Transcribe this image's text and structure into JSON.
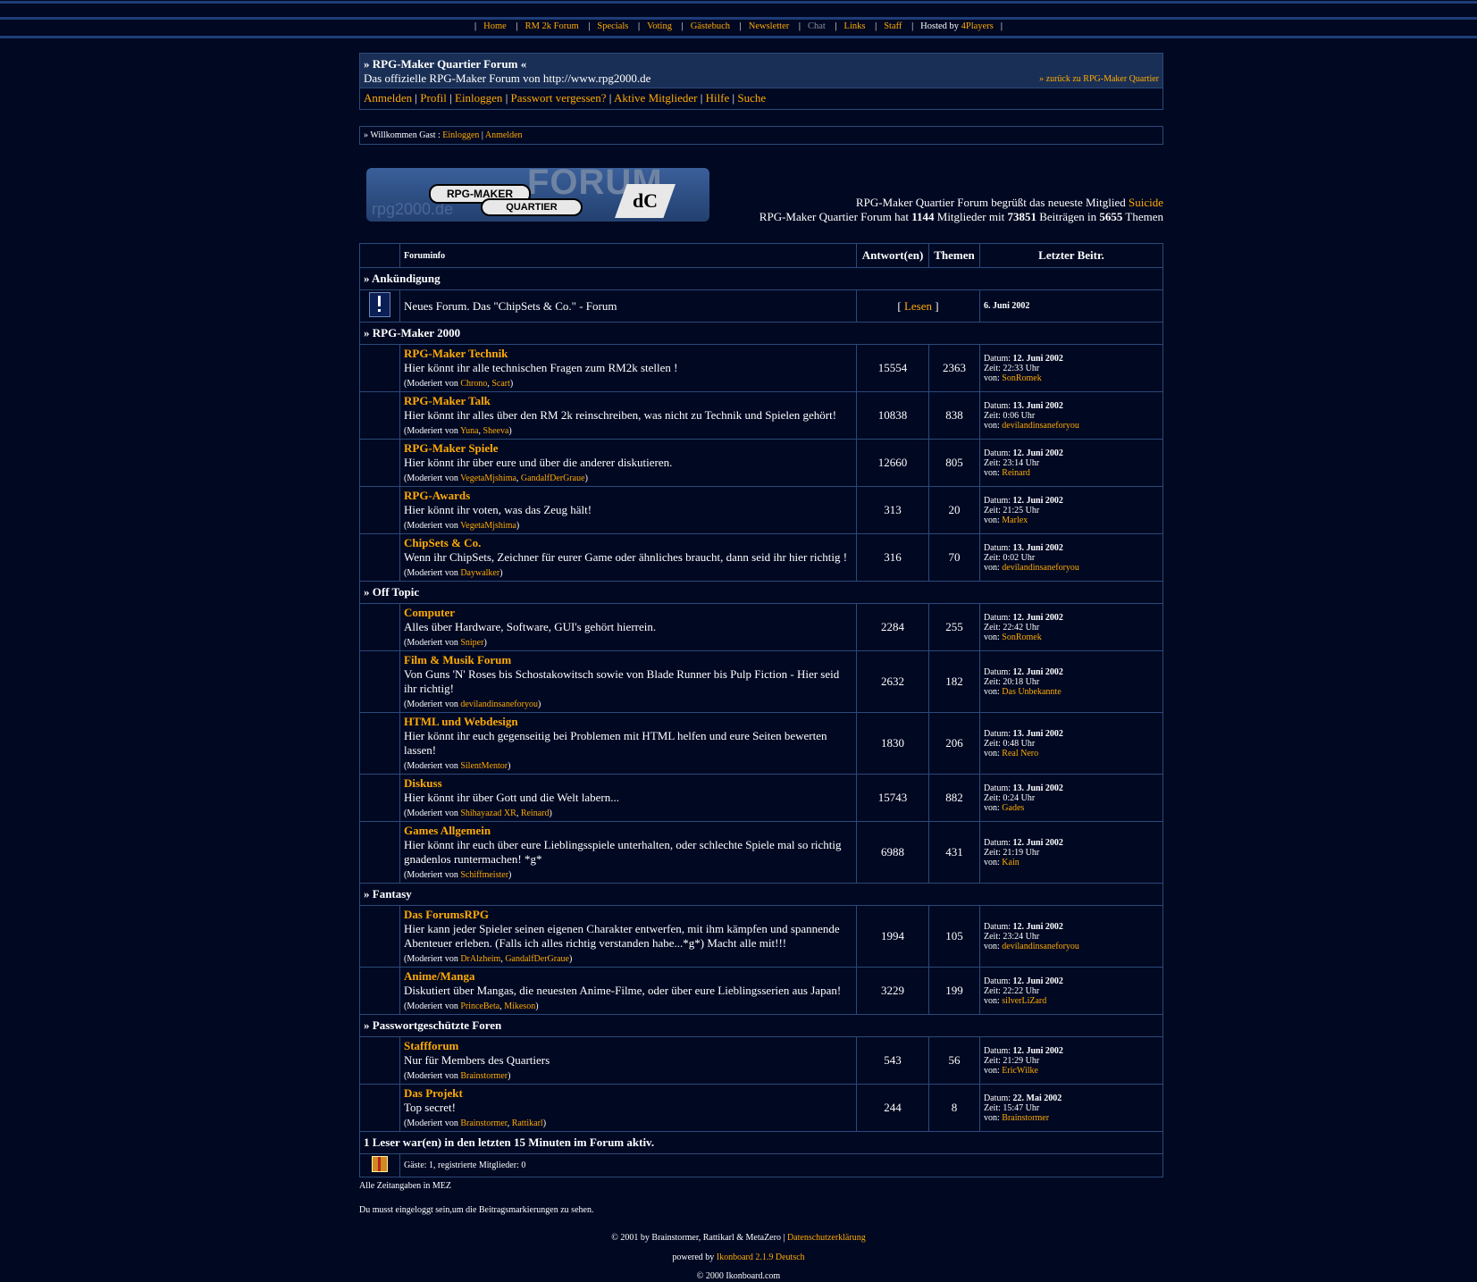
{
  "topnav": {
    "home": "Home",
    "rm2k": "RM 2k Forum",
    "specials": "Specials",
    "voting": "Voting",
    "guestbook": "Gästebuch",
    "newsletter": "Newsletter",
    "chat": "Chat",
    "links": "Links",
    "staff": "Staff",
    "hosted_prefix": "Hosted by",
    "hosted_name": "4Players"
  },
  "header": {
    "title": "» RPG-Maker Quartier Forum «",
    "subtitle": "Das offizielle RPG-Maker Forum von http://www.rpg2000.de",
    "back_link": "» zurück zu RPG-Maker Quartier"
  },
  "usernav": [
    "Anmelden",
    "Profil",
    "Einloggen",
    "Passwort vergessen?",
    "Aktive Mitglieder",
    "Hilfe",
    "Suche"
  ],
  "welcome": {
    "prefix": "» Willkommen Gast :",
    "login": "Einloggen",
    "register": "Anmelden"
  },
  "logo": {
    "line1": "RPG-MAKER",
    "line2": "QUARTIER",
    "big": "FORUM",
    "faint": "rpg2000.de",
    "badge": "dC"
  },
  "stats": {
    "line1_prefix": "RPG-Maker Quartier Forum begrüßt das neueste Mitglied",
    "newest_member": "Suicide",
    "line2_a": "RPG-Maker Quartier Forum hat",
    "members": "1144",
    "line2_b": "Mitglieder mit",
    "posts": "73851",
    "line2_c": "Beiträgen in",
    "topics": "5655",
    "line2_d": "Themen"
  },
  "columns": {
    "info": "Foruminfo",
    "replies": "Antwort(en)",
    "topics": "Themen",
    "last": "Letzter Beitr."
  },
  "announcement": {
    "category": "» Ankündigung",
    "text": "Neues Forum. Das \"ChipSets & Co.\" - Forum",
    "read": "Lesen",
    "date": "6. Juni 2002"
  },
  "labels": {
    "moderated": "(Moderiert von",
    "date": "Datum:",
    "time": "Zeit:",
    "by": "von:"
  },
  "categories": [
    {
      "name": "» RPG-Maker 2000",
      "forums": [
        {
          "name": "RPG-Maker Technik",
          "desc": "Hier könnt ihr alle technischen Fragen zum RM2k stellen !",
          "mods": [
            "Chrono",
            "Scart"
          ],
          "replies": "15554",
          "topics": "2363",
          "date": "12. Juni 2002",
          "time": "22:33 Uhr",
          "by": "SonRomek"
        },
        {
          "name": "RPG-Maker Talk",
          "desc": "Hier könnt ihr alles über den RM 2k reinschreiben, was nicht zu Technik und Spielen gehört!",
          "mods": [
            "Yuna",
            "Sheeva"
          ],
          "replies": "10838",
          "topics": "838",
          "date": "13. Juni 2002",
          "time": "0:06 Uhr",
          "by": "devilandinsaneforyou"
        },
        {
          "name": "RPG-Maker Spiele",
          "desc": "Hier könnt ihr über eure und über die anderer diskutieren.",
          "mods": [
            "VegetaMjshima",
            "GandalfDerGraue"
          ],
          "replies": "12660",
          "topics": "805",
          "date": "12. Juni 2002",
          "time": "23:14 Uhr",
          "by": "Reinard"
        },
        {
          "name": "RPG-Awards",
          "desc": "Hier könnt ihr voten, was das Zeug hält!",
          "mods": [
            "VegetaMjshima"
          ],
          "replies": "313",
          "topics": "20",
          "date": "12. Juni 2002",
          "time": "21:25 Uhr",
          "by": "Marlex"
        },
        {
          "name": "ChipSets & Co.",
          "desc": "Wenn ihr ChipSets, Zeichner für eurer Game oder ähnliches braucht, dann seid ihr hier richtig !",
          "mods": [
            "Daywalker"
          ],
          "replies": "316",
          "topics": "70",
          "date": "13. Juni 2002",
          "time": "0:02 Uhr",
          "by": "devilandinsaneforyou"
        }
      ]
    },
    {
      "name": "» Off Topic",
      "forums": [
        {
          "name": "Computer",
          "desc": "Alles über Hardware, Software, GUI's gehört hierrein.",
          "mods": [
            "Sniper"
          ],
          "replies": "2284",
          "topics": "255",
          "date": "12. Juni 2002",
          "time": "22:42 Uhr",
          "by": "SonRomek"
        },
        {
          "name": "Film & Musik Forum",
          "desc": "Von Guns 'N' Roses bis Schostakowitsch sowie von Blade Runner bis Pulp Fiction - Hier seid ihr richtig!",
          "mods": [
            "devilandinsaneforyou"
          ],
          "replies": "2632",
          "topics": "182",
          "date": "12. Juni 2002",
          "time": "20:18 Uhr",
          "by": "Das Unbekannte"
        },
        {
          "name": "HTML und Webdesign",
          "desc": "Hier könnt ihr euch gegenseitig bei Problemen mit HTML helfen und eure Seiten bewerten lassen!",
          "mods": [
            "SilentMentor"
          ],
          "replies": "1830",
          "topics": "206",
          "date": "13. Juni 2002",
          "time": "0:48 Uhr",
          "by": "Real Nero"
        },
        {
          "name": "Diskuss",
          "desc": "Hier könnt ihr über Gott und die Welt labern...",
          "mods": [
            "Shihayazad XR",
            "Reinard"
          ],
          "replies": "15743",
          "topics": "882",
          "date": "13. Juni 2002",
          "time": "0:24 Uhr",
          "by": "Gades"
        },
        {
          "name": "Games Allgemein",
          "desc": "Hier könnt ihr euch über eure Lieblingsspiele unterhalten, oder schlechte Spiele mal so richtig gnadenlos runtermachen! *g*",
          "mods": [
            "Schiffmeister"
          ],
          "replies": "6988",
          "topics": "431",
          "date": "12. Juni 2002",
          "time": "21:19 Uhr",
          "by": "Kain"
        }
      ]
    },
    {
      "name": "» Fantasy",
      "forums": [
        {
          "name": "Das ForumsRPG",
          "desc": "Hier kann jeder Spieler seinen eigenen Charakter entwerfen, mit ihm kämpfen und spannende Abenteuer erleben. (Falls ich alles richtig verstanden habe...*g*)   Macht alle mit!!!",
          "mods": [
            "DrAlzheim",
            "GandalfDerGraue"
          ],
          "replies": "1994",
          "topics": "105",
          "date": "12. Juni 2002",
          "time": "23:24 Uhr",
          "by": "devilandinsaneforyou"
        },
        {
          "name": "Anime/Manga",
          "desc": "Diskutiert über Mangas, die neuesten Anime-Filme, oder über eure Lieblingsserien aus Japan!",
          "mods": [
            "PrinceBeta",
            "Mikeson"
          ],
          "replies": "3229",
          "topics": "199",
          "date": "12. Juni 2002",
          "time": "22:22 Uhr",
          "by": "silverLiZard"
        }
      ]
    },
    {
      "name": "» Passwortgeschützte Foren",
      "forums": [
        {
          "name": "Staffforum",
          "desc": "Nur für Members des Quartiers",
          "mods": [
            "Brainstormer"
          ],
          "replies": "543",
          "topics": "56",
          "date": "12. Juni 2002",
          "time": "21:29 Uhr",
          "by": "EricWilke"
        },
        {
          "name": "Das Projekt",
          "desc": "Top secret!",
          "mods": [
            "Brainstormer",
            "Rattikarl"
          ],
          "replies": "244",
          "topics": "8",
          "date": "22. Mai 2002",
          "time": "15:47 Uhr",
          "by": "Brainstormer"
        }
      ]
    }
  ],
  "active": {
    "title": "1 Leser war(en) in den letzten 15 Minuten im Forum aktiv.",
    "detail": "Gäste: 1, registrierte Mitglieder: 0"
  },
  "footer": {
    "tz": "Alle Zeitangaben in MEZ",
    "note": "Du musst eingeloggt sein,um die Beitragsmarkierungen zu sehen.",
    "copy1": "© 2001 by Brainstormer, Rattikarl & MetaZero |",
    "privacy": "Datenschutzerklärung",
    "powered_prefix": "powered by",
    "powered_link": "Ikonboard 2.1.9 Deutsch",
    "copy2": "© 2000 Ikonboard.com"
  }
}
